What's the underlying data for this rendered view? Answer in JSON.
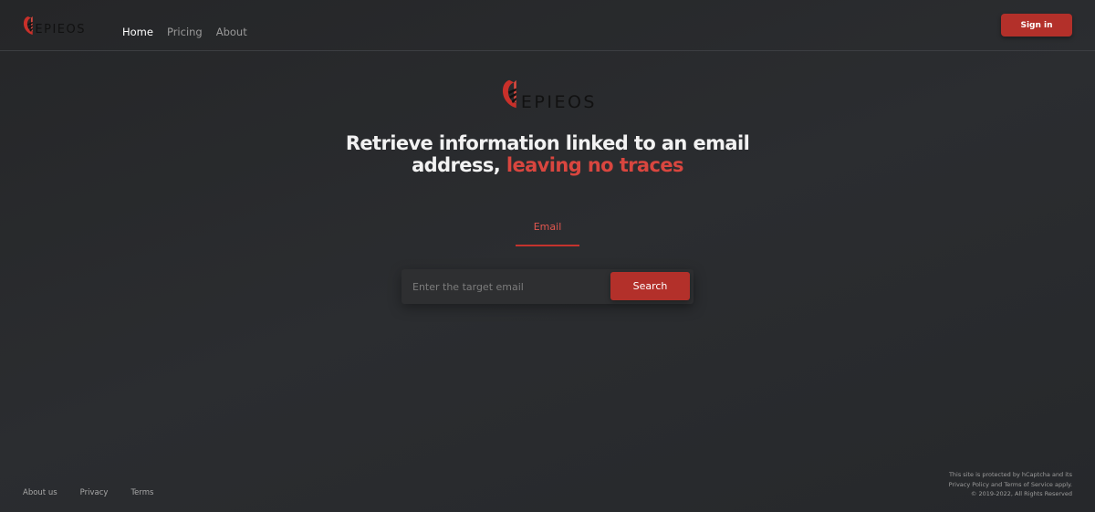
{
  "brand": {
    "name": "EPIEOS",
    "accent_color": "#c5332d"
  },
  "nav": {
    "items": [
      {
        "label": "Home",
        "active": true
      },
      {
        "label": "Pricing",
        "active": false
      },
      {
        "label": "About",
        "active": false
      }
    ]
  },
  "header": {
    "signin_label": "Sign in"
  },
  "hero": {
    "logo_text": "EPIEOS",
    "headline_part1": "Retrieve information linked to an email address, ",
    "headline_accent": "leaving no traces"
  },
  "search": {
    "tab_label": "Email",
    "placeholder": "Enter the target email",
    "button_label": "Search"
  },
  "footer": {
    "links": [
      "About us",
      "Privacy",
      "Terms"
    ],
    "captcha_line1": "This site is protected by hCaptcha and its",
    "captcha_line2": "Privacy Policy and Terms of Service apply.",
    "copyright": "© 2019-2022, All Rights Reserved"
  }
}
